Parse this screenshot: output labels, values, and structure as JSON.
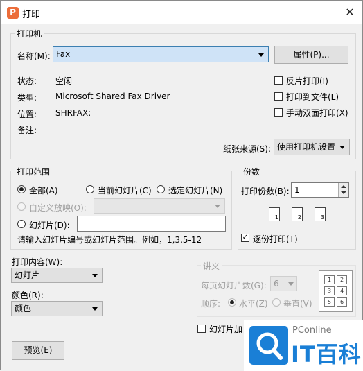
{
  "window": {
    "title": "打印",
    "app_icon_letter": "P",
    "close_glyph": "✕"
  },
  "printer": {
    "group_label": "打印机",
    "name_label": "名称(M):",
    "name_value": "Fax",
    "properties_button": "属性(P)...",
    "status_label": "状态:",
    "status_value": "空闲",
    "type_label": "类型:",
    "type_value": "Microsoft Shared Fax Driver",
    "location_label": "位置:",
    "location_value": "SHRFAX:",
    "comment_label": "备注:",
    "reverse_print": "反片打印(I)",
    "print_to_file": "打印到文件(L)",
    "manual_duplex": "手动双面打印(X)",
    "paper_source_label": "纸张来源(S):",
    "paper_source_value": "使用打印机设置"
  },
  "range": {
    "group_label": "打印范围",
    "all": "全部(A)",
    "current": "当前幻灯片(C)",
    "selected": "选定幻灯片(N)",
    "custom_show": "自定义放映(O):",
    "slides": "幻灯片(D):",
    "slides_value": "",
    "hint": "请输入幻灯片编号或幻灯片范围。例如，1,3,5-12"
  },
  "copies": {
    "group_label": "份数",
    "count_label": "打印份数(B):",
    "count_value": "1",
    "collate": "逐份打印(T)",
    "page_labels": [
      "1",
      "2",
      "3"
    ]
  },
  "content": {
    "print_what_label": "打印内容(W):",
    "print_what_value": "幻灯片",
    "color_label": "颜色(R):",
    "color_value": "颜色"
  },
  "handouts": {
    "group_label": "讲义",
    "per_page_label": "每页幻灯片数(G):",
    "per_page_value": "6",
    "order_label": "顺序:",
    "horizontal": "水平(Z)",
    "vertical": "垂直(V)",
    "preview_slots": [
      "1",
      "2",
      "3",
      "4",
      "5",
      "6"
    ]
  },
  "frame_slides": "幻灯片加",
  "preview_button": "预览(E)",
  "watermark": {
    "brand": "PConline",
    "chinese": "IT百科",
    "accent": "#1a7fd6"
  }
}
